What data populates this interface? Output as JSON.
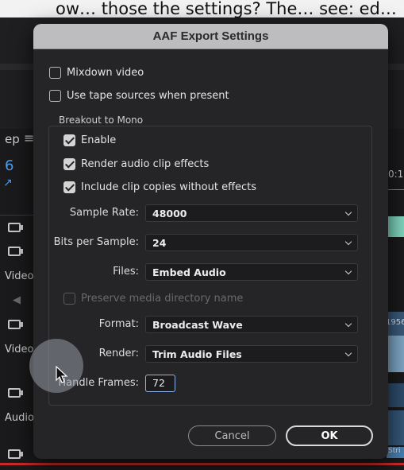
{
  "background": {
    "caption": "ow… those the settings? The… see: ed… ",
    "left_items": [
      "ep",
      "6",
      "Video",
      "Video",
      "Audio"
    ],
    "right_items": [
      "0:1",
      "1956",
      "Stri"
    ],
    "menu_icon": "hamburger-icon"
  },
  "dialog": {
    "title": "AAF Export Settings",
    "options": [
      {
        "label": "Mixdown video",
        "checked": false
      },
      {
        "label": "Use tape sources when present",
        "checked": false
      }
    ],
    "breakout": {
      "title": "Breakout to Mono",
      "checkboxes": [
        {
          "label": "Enable",
          "checked": true
        },
        {
          "label": "Render audio clip effects",
          "checked": true
        },
        {
          "label": "Include clip copies without effects",
          "checked": true
        }
      ],
      "sample_rate": {
        "label": "Sample Rate:",
        "value": "48000"
      },
      "bits_per_sample": {
        "label": "Bits per Sample:",
        "value": "24"
      },
      "files": {
        "label": "Files:",
        "value": "Embed Audio"
      },
      "preserve": {
        "label": "Preserve media directory name",
        "checked": false,
        "disabled": true
      },
      "format": {
        "label": "Format:",
        "value": "Broadcast Wave"
      },
      "render": {
        "label": "Render:",
        "value": "Trim Audio Files"
      },
      "handle_frames": {
        "label": "Handle Frames:",
        "value": "72"
      }
    },
    "buttons": {
      "cancel": "Cancel",
      "ok": "OK"
    }
  },
  "colors": {
    "dialog_bg": "#252527",
    "title_bar": "#bdbdbf",
    "focus": "#8fb5ea",
    "scrub": "#c82a2a",
    "timeline_green": "#7fd8c0"
  }
}
